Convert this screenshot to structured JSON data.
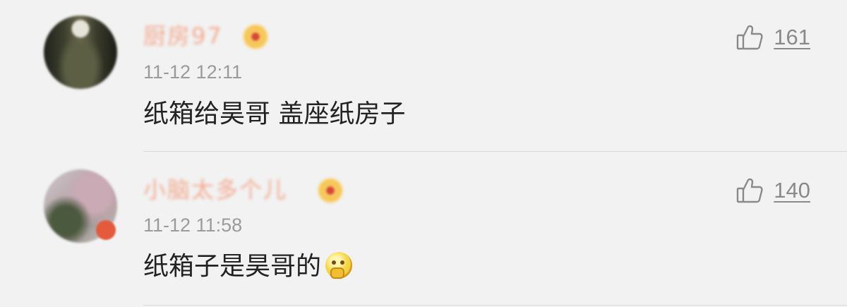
{
  "comments": [
    {
      "username": "厨房97",
      "timestamp": "11-12 12:11",
      "content": "纸箱给昊哥  盖座纸房子",
      "like_count": "161",
      "like_icon": "thumbs-up-icon"
    },
    {
      "username": "小脑太多个儿",
      "timestamp": "11-12 11:58",
      "content": "纸箱子是昊哥的",
      "emoji": "thinking-emoji",
      "like_count": "140",
      "like_icon": "thumbs-up-icon"
    }
  ]
}
